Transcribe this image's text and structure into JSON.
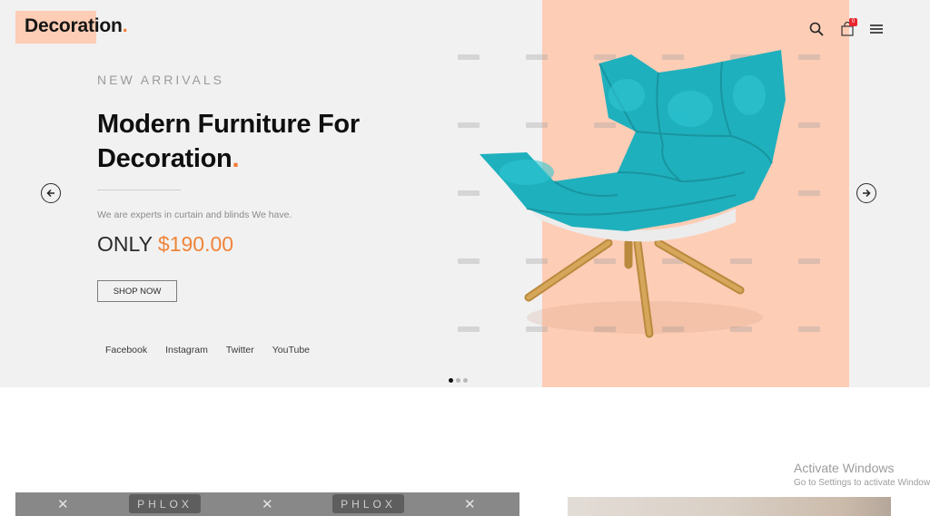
{
  "header": {
    "logo": {
      "text": "Decoration",
      "dot": ".",
      "accent_color": "#f07a32"
    },
    "icons": [
      {
        "name": "search-icon"
      },
      {
        "name": "shopping-bag-icon",
        "badge": "0"
      },
      {
        "name": "hamburger-menu-icon"
      }
    ]
  },
  "hero": {
    "eyebrow": "NEW ARRIVALS",
    "headline_line1": "Modern Furniture For",
    "headline_line2": "Decoration",
    "headline_dot": ".",
    "description": "We are experts in curtain and blinds We have.",
    "price_prefix": "ONLY",
    "price_amount": "$190.00",
    "cta_label": "SHOP NOW",
    "socials": [
      "Facebook",
      "Instagram",
      "Twitter",
      "YouTube"
    ],
    "prev_icon": "arrow-left-icon",
    "next_icon": "arrow-right-icon",
    "slides": {
      "count": 3,
      "active": 1
    },
    "colors": {
      "panel": "#fecdb6",
      "background": "#f1f1f1",
      "accent": "#f0843b",
      "chair": "#1fb0bd"
    }
  },
  "bottom": {
    "strip_logo": "PHLOX",
    "strip_close": "✕"
  },
  "os_watermark": {
    "title": "Activate Windows",
    "subtitle": "Go to Settings to activate Windows."
  }
}
